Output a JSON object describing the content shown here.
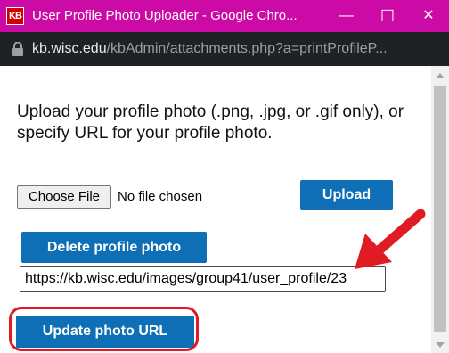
{
  "window": {
    "title": "User Profile Photo Uploader - Google Chro...",
    "app_icon_text": "KB",
    "minimize": "—",
    "maximize": "☐",
    "close": "✕"
  },
  "address_bar": {
    "domain": "kb.wisc.edu",
    "path": "/kbAdmin/attachments.php?a=printProfileP..."
  },
  "page": {
    "instructions": "Upload your profile photo (.png, .jpg, or .gif only), or specify URL for your profile photo.",
    "choose_file_label": "Choose File",
    "no_file_text": "No file chosen",
    "upload_label": "Upload",
    "delete_label": "Delete profile photo",
    "photo_url_value": "https://kb.wisc.edu/images/group41/user_profile/23",
    "update_label": "Update photo URL"
  },
  "colors": {
    "titlebar": "#cc0aa6",
    "button_blue": "#0f6fb6",
    "annotation_red": "#e01b24"
  }
}
